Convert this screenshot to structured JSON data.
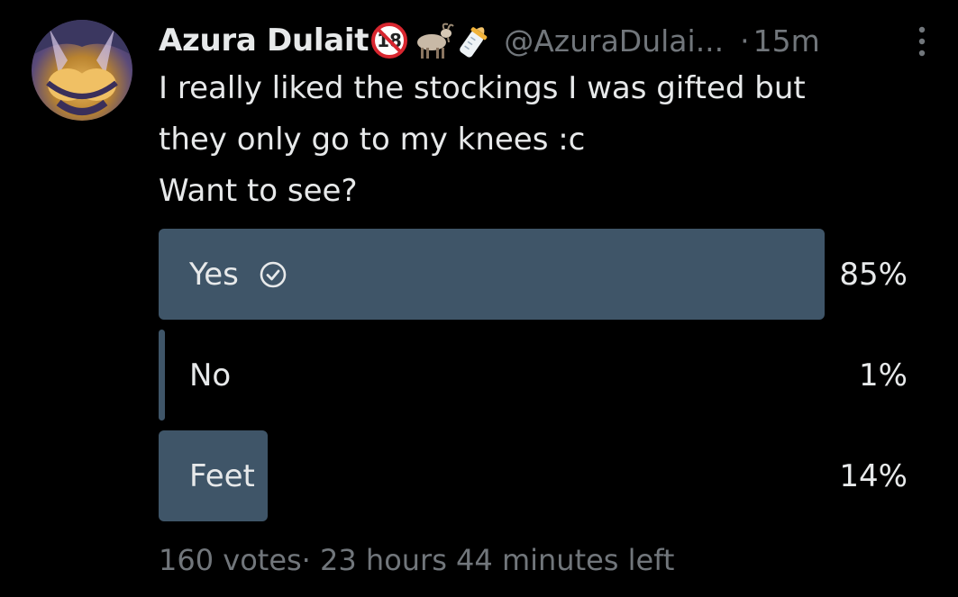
{
  "tweet": {
    "display_name": "Azura Dulait",
    "name_emojis": [
      "no-under-18-icon",
      "goat-icon",
      "baby-bottle-icon"
    ],
    "handle": "@AzuraDulai...",
    "separator": "·",
    "timestamp": "15m",
    "text_lines": [
      "I really liked the stockings I was gifted but",
      "they only go to my knees :c",
      "Want to see?"
    ]
  },
  "poll": {
    "options": [
      {
        "label": "Yes",
        "percent_text": "85%",
        "fill_fraction": 0.885,
        "selected": true
      },
      {
        "label": "No",
        "percent_text": "1%",
        "fill_fraction": 0.008,
        "selected": false
      },
      {
        "label": "Feet",
        "percent_text": "14%",
        "fill_fraction": 0.145,
        "selected": false
      }
    ],
    "footer": "160 votes· 23 hours 44 minutes left"
  },
  "colors": {
    "background": "#000000",
    "bar_fill": "#3f5568",
    "primary_text": "#e7e9ea",
    "secondary_text": "#71767b"
  }
}
